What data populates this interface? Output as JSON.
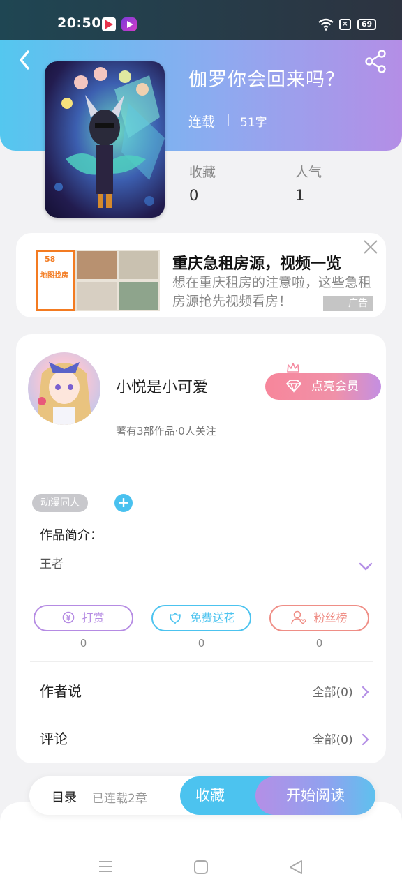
{
  "status_bar": {
    "time": "20:50",
    "battery": "69",
    "sim_indicator": "×"
  },
  "book": {
    "title": "伽罗你会回来吗？",
    "status": "连载",
    "word_count": "51字",
    "stats": [
      {
        "label": "收藏",
        "value": "0"
      },
      {
        "label": "人气",
        "value": "1"
      }
    ]
  },
  "ad": {
    "title": "重庆急租房源，视频一览",
    "description": "想在重庆租房的注意啦，这些急租房源抢先视频看房！",
    "tag": "广告",
    "thumb_brand": "58",
    "thumb_name": "地图找房"
  },
  "author": {
    "name": "小悦是小可爱",
    "meta": "著有3部作品·0人关注",
    "vip_label": "点亮会员"
  },
  "work": {
    "tag": "动漫同人",
    "add_tag_symbol": "+",
    "intro_label": "作品简介：",
    "intro_text": "王者"
  },
  "actions": [
    {
      "label": "打赏",
      "count": "0",
      "color": "#b58be3",
      "icon": "yen-icon"
    },
    {
      "label": "免费送花",
      "count": "0",
      "color": "#4cc3ef",
      "icon": "flower-icon"
    },
    {
      "label": "粉丝榜",
      "count": "0",
      "color": "#ef8e86",
      "icon": "fans-icon"
    }
  ],
  "rows": [
    {
      "label": "作者说",
      "right": "全部(0)"
    },
    {
      "label": "评论",
      "right": "全部(0)"
    }
  ],
  "bottom_bar": {
    "toc_label": "目录",
    "toc_count": "已连载2章",
    "collect_label": "收藏",
    "read_label": "开始阅读"
  },
  "colors": {
    "accent_blue": "#4cc3ef",
    "accent_purple": "#b48fe6",
    "vip_pink": "#f7869b"
  }
}
